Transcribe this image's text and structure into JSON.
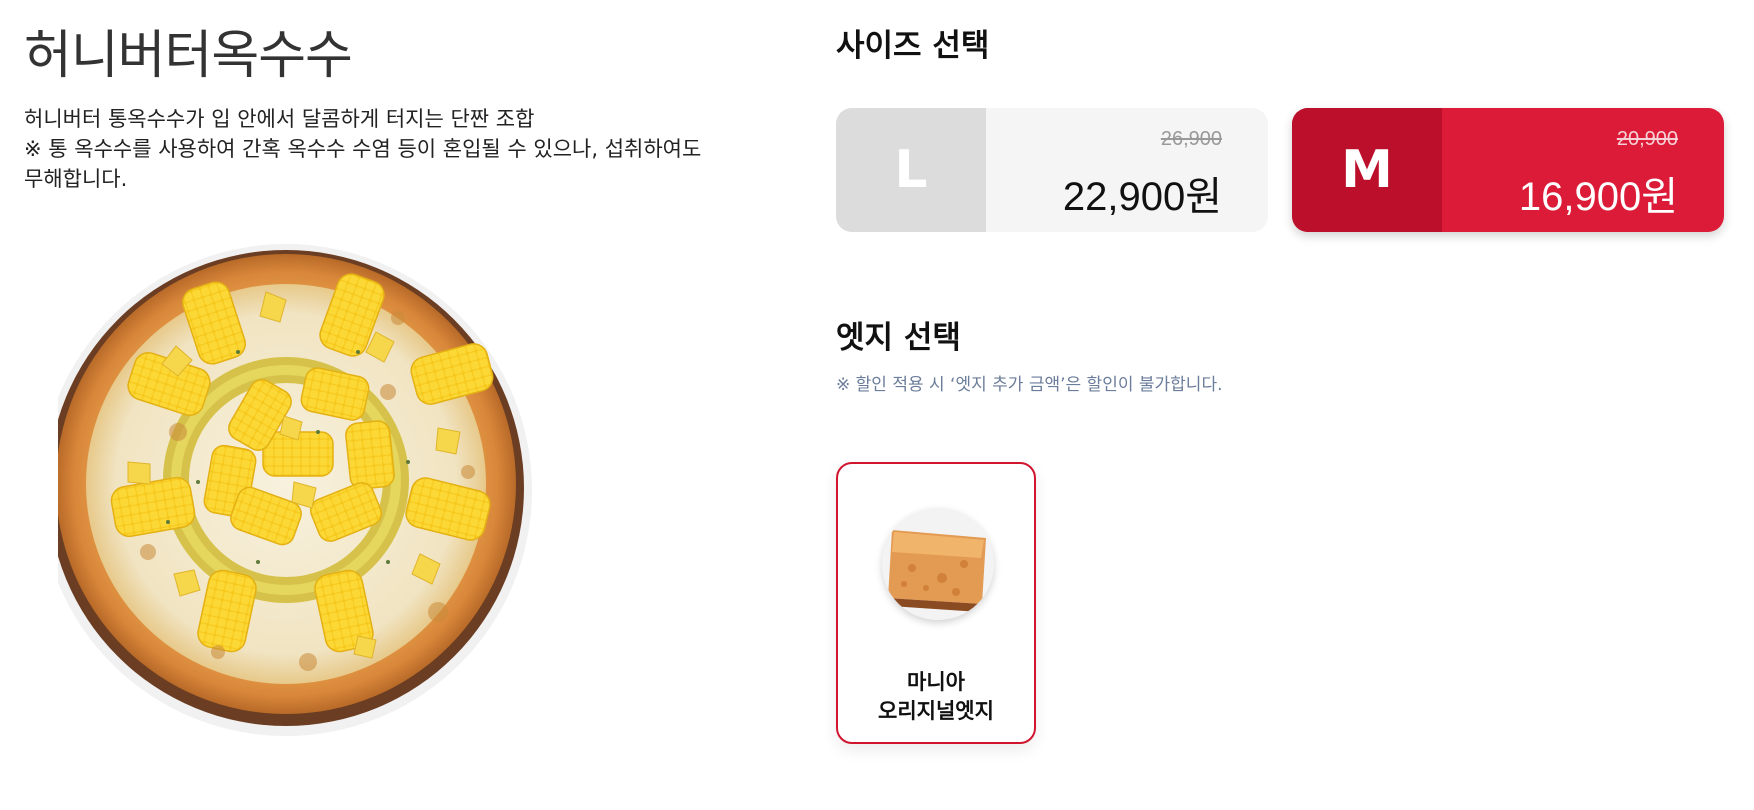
{
  "product": {
    "title": "허니버터옥수수",
    "description": "허니버터 통옥수수가 입 안에서 달콤하게 터지는 단짠 조합\n※ 통 옥수수를 사용하여 간혹 옥수수 수염 등이 혼입될 수 있으나, 섭취하여도\n무해합니다."
  },
  "size_section": {
    "title": "사이즈 선택",
    "options": [
      {
        "size": "L",
        "original_price": "26,900",
        "price": "22,900원",
        "selected": false
      },
      {
        "size": "M",
        "original_price": "20,900",
        "price": "16,900원",
        "selected": true
      }
    ]
  },
  "edge_section": {
    "title": "엣지 선택",
    "note": "※ 할인 적용 시 ‘엣지 추가 금액’은 할인이 불가합니다.",
    "options": [
      {
        "name": "마니아\n오리지널엣지",
        "selected": true
      }
    ]
  },
  "colors": {
    "accent": "#db1b37",
    "accent_dark": "#bb0f2b",
    "note_text": "#6b7d9a"
  }
}
